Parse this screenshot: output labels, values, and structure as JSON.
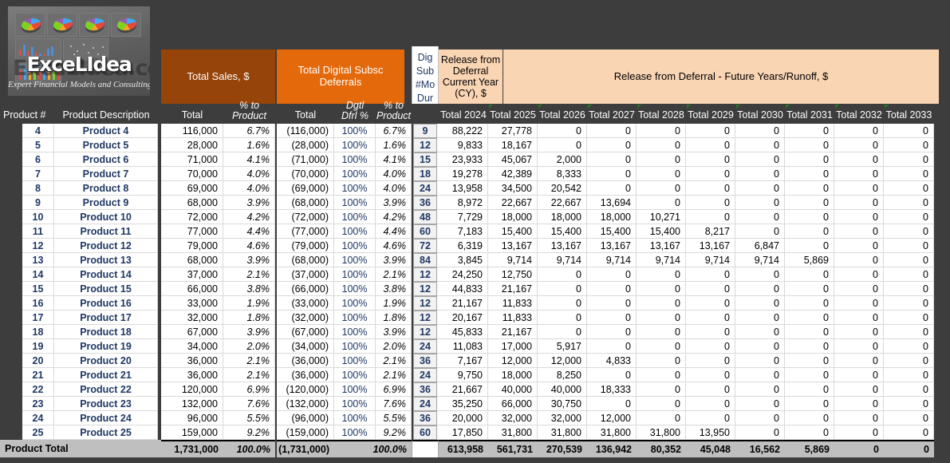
{
  "logo": {
    "brand": "ExceLIdea",
    "watermark": "ExceLIdea.com",
    "tagline": "Expert Financial Models and Consulting Services"
  },
  "bands": {
    "total_sales": "Total Sales, $",
    "digital_deferrals": "Total Digital Subsc Deferrals",
    "dig_sub_dur": "Dig Sub #Mo Dur Asmp",
    "release_cy": "Release from Deferral Current Year (CY), $",
    "release_future": "Release from Deferral - Future Years/Runoff, $"
  },
  "columns": {
    "product_num": "Product #",
    "product_desc": "Product Description",
    "sales_total": "Total",
    "sales_pct": "% to Product",
    "sales_pct_l1": "% to",
    "sales_pct_l2": "Product",
    "dfrl_total": "Total",
    "dfrl_pct_l1": "Dgtl",
    "dfrl_pct_l2": "Dfrl  %",
    "dfrl_to_prod_l1": "% to",
    "dfrl_to_prod_l2": "Product",
    "years": [
      "Total 2024",
      "Total 2025",
      "Total 2026",
      "Total 2027",
      "Total 2028",
      "Total 2029",
      "Total 2030",
      "Total 2031",
      "Total 2032",
      "Total 2033"
    ]
  },
  "colors": {
    "brown": "#96440a",
    "orange": "#e3690b",
    "peach": "#fad5b4",
    "dark_header": "#3d3d3d",
    "total_row": "#bfbfbf",
    "text_blue": "#1f3864",
    "comment_marker": "#1f7a1f"
  },
  "rows": [
    {
      "num": "4",
      "desc": "Product 4",
      "sales": "116,000",
      "pct": "6.7%",
      "dfrl": "(116,000)",
      "dfrl_pct": "100%",
      "dfrl_prod": "6.7%",
      "dur": "9",
      "y": [
        "88,222",
        "27,778",
        "0",
        "0",
        "0",
        "0",
        "0",
        "0",
        "0",
        "0"
      ]
    },
    {
      "num": "5",
      "desc": "Product 5",
      "sales": "28,000",
      "pct": "1.6%",
      "dfrl": "(28,000)",
      "dfrl_pct": "100%",
      "dfrl_prod": "1.6%",
      "dur": "12",
      "y": [
        "9,833",
        "18,167",
        "0",
        "0",
        "0",
        "0",
        "0",
        "0",
        "0",
        "0"
      ]
    },
    {
      "num": "6",
      "desc": "Product 6",
      "sales": "71,000",
      "pct": "4.1%",
      "dfrl": "(71,000)",
      "dfrl_pct": "100%",
      "dfrl_prod": "4.1%",
      "dur": "15",
      "y": [
        "23,933",
        "45,067",
        "2,000",
        "0",
        "0",
        "0",
        "0",
        "0",
        "0",
        "0"
      ]
    },
    {
      "num": "7",
      "desc": "Product 7",
      "sales": "70,000",
      "pct": "4.0%",
      "dfrl": "(70,000)",
      "dfrl_pct": "100%",
      "dfrl_prod": "4.0%",
      "dur": "18",
      "y": [
        "19,278",
        "42,389",
        "8,333",
        "0",
        "0",
        "0",
        "0",
        "0",
        "0",
        "0"
      ]
    },
    {
      "num": "8",
      "desc": "Product 8",
      "sales": "69,000",
      "pct": "4.0%",
      "dfrl": "(69,000)",
      "dfrl_pct": "100%",
      "dfrl_prod": "4.0%",
      "dur": "24",
      "y": [
        "13,958",
        "34,500",
        "20,542",
        "0",
        "0",
        "0",
        "0",
        "0",
        "0",
        "0"
      ]
    },
    {
      "num": "9",
      "desc": "Product 9",
      "sales": "68,000",
      "pct": "3.9%",
      "dfrl": "(68,000)",
      "dfrl_pct": "100%",
      "dfrl_prod": "3.9%",
      "dur": "36",
      "y": [
        "8,972",
        "22,667",
        "22,667",
        "13,694",
        "0",
        "0",
        "0",
        "0",
        "0",
        "0"
      ]
    },
    {
      "num": "10",
      "desc": "Product 10",
      "sales": "72,000",
      "pct": "4.2%",
      "dfrl": "(72,000)",
      "dfrl_pct": "100%",
      "dfrl_prod": "4.2%",
      "dur": "48",
      "y": [
        "7,729",
        "18,000",
        "18,000",
        "18,000",
        "10,271",
        "0",
        "0",
        "0",
        "0",
        "0"
      ]
    },
    {
      "num": "11",
      "desc": "Product 11",
      "sales": "77,000",
      "pct": "4.4%",
      "dfrl": "(77,000)",
      "dfrl_pct": "100%",
      "dfrl_prod": "4.4%",
      "dur": "60",
      "y": [
        "7,183",
        "15,400",
        "15,400",
        "15,400",
        "15,400",
        "8,217",
        "0",
        "0",
        "0",
        "0"
      ]
    },
    {
      "num": "12",
      "desc": "Product 12",
      "sales": "79,000",
      "pct": "4.6%",
      "dfrl": "(79,000)",
      "dfrl_pct": "100%",
      "dfrl_prod": "4.6%",
      "dur": "72",
      "y": [
        "6,319",
        "13,167",
        "13,167",
        "13,167",
        "13,167",
        "13,167",
        "6,847",
        "0",
        "0",
        "0"
      ]
    },
    {
      "num": "13",
      "desc": "Product 13",
      "sales": "68,000",
      "pct": "3.9%",
      "dfrl": "(68,000)",
      "dfrl_pct": "100%",
      "dfrl_prod": "3.9%",
      "dur": "84",
      "y": [
        "3,845",
        "9,714",
        "9,714",
        "9,714",
        "9,714",
        "9,714",
        "9,714",
        "5,869",
        "0",
        "0"
      ]
    },
    {
      "num": "14",
      "desc": "Product 14",
      "sales": "37,000",
      "pct": "2.1%",
      "dfrl": "(37,000)",
      "dfrl_pct": "100%",
      "dfrl_prod": "2.1%",
      "dur": "12",
      "y": [
        "24,250",
        "12,750",
        "0",
        "0",
        "0",
        "0",
        "0",
        "0",
        "0",
        "0"
      ]
    },
    {
      "num": "15",
      "desc": "Product 15",
      "sales": "66,000",
      "pct": "3.8%",
      "dfrl": "(66,000)",
      "dfrl_pct": "100%",
      "dfrl_prod": "3.8%",
      "dur": "12",
      "y": [
        "44,833",
        "21,167",
        "0",
        "0",
        "0",
        "0",
        "0",
        "0",
        "0",
        "0"
      ]
    },
    {
      "num": "16",
      "desc": "Product 16",
      "sales": "33,000",
      "pct": "1.9%",
      "dfrl": "(33,000)",
      "dfrl_pct": "100%",
      "dfrl_prod": "1.9%",
      "dur": "12",
      "y": [
        "21,167",
        "11,833",
        "0",
        "0",
        "0",
        "0",
        "0",
        "0",
        "0",
        "0"
      ]
    },
    {
      "num": "17",
      "desc": "Product 17",
      "sales": "32,000",
      "pct": "1.8%",
      "dfrl": "(32,000)",
      "dfrl_pct": "100%",
      "dfrl_prod": "1.8%",
      "dur": "12",
      "y": [
        "20,167",
        "11,833",
        "0",
        "0",
        "0",
        "0",
        "0",
        "0",
        "0",
        "0"
      ]
    },
    {
      "num": "18",
      "desc": "Product 18",
      "sales": "67,000",
      "pct": "3.9%",
      "dfrl": "(67,000)",
      "dfrl_pct": "100%",
      "dfrl_prod": "3.9%",
      "dur": "12",
      "y": [
        "45,833",
        "21,167",
        "0",
        "0",
        "0",
        "0",
        "0",
        "0",
        "0",
        "0"
      ]
    },
    {
      "num": "19",
      "desc": "Product 19",
      "sales": "34,000",
      "pct": "2.0%",
      "dfrl": "(34,000)",
      "dfrl_pct": "100%",
      "dfrl_prod": "2.0%",
      "dur": "24",
      "y": [
        "11,083",
        "17,000",
        "5,917",
        "0",
        "0",
        "0",
        "0",
        "0",
        "0",
        "0"
      ]
    },
    {
      "num": "20",
      "desc": "Product 20",
      "sales": "36,000",
      "pct": "2.1%",
      "dfrl": "(36,000)",
      "dfrl_pct": "100%",
      "dfrl_prod": "2.1%",
      "dur": "36",
      "y": [
        "7,167",
        "12,000",
        "12,000",
        "4,833",
        "0",
        "0",
        "0",
        "0",
        "0",
        "0"
      ]
    },
    {
      "num": "21",
      "desc": "Product 21",
      "sales": "36,000",
      "pct": "2.1%",
      "dfrl": "(36,000)",
      "dfrl_pct": "100%",
      "dfrl_prod": "2.1%",
      "dur": "24",
      "y": [
        "9,750",
        "18,000",
        "8,250",
        "0",
        "0",
        "0",
        "0",
        "0",
        "0",
        "0"
      ]
    },
    {
      "num": "22",
      "desc": "Product 22",
      "sales": "120,000",
      "pct": "6.9%",
      "dfrl": "(120,000)",
      "dfrl_pct": "100%",
      "dfrl_prod": "6.9%",
      "dur": "36",
      "y": [
        "21,667",
        "40,000",
        "40,000",
        "18,333",
        "0",
        "0",
        "0",
        "0",
        "0",
        "0"
      ]
    },
    {
      "num": "23",
      "desc": "Product 23",
      "sales": "132,000",
      "pct": "7.6%",
      "dfrl": "(132,000)",
      "dfrl_pct": "100%",
      "dfrl_prod": "7.6%",
      "dur": "24",
      "y": [
        "35,250",
        "66,000",
        "30,750",
        "0",
        "0",
        "0",
        "0",
        "0",
        "0",
        "0"
      ]
    },
    {
      "num": "24",
      "desc": "Product 24",
      "sales": "96,000",
      "pct": "5.5%",
      "dfrl": "(96,000)",
      "dfrl_pct": "100%",
      "dfrl_prod": "5.5%",
      "dur": "36",
      "y": [
        "20,000",
        "32,000",
        "32,000",
        "12,000",
        "0",
        "0",
        "0",
        "0",
        "0",
        "0"
      ]
    },
    {
      "num": "25",
      "desc": "Product 25",
      "sales": "159,000",
      "pct": "9.2%",
      "dfrl": "(159,000)",
      "dfrl_pct": "100%",
      "dfrl_prod": "9.2%",
      "dur": "60",
      "y": [
        "17,850",
        "31,800",
        "31,800",
        "31,800",
        "31,800",
        "13,950",
        "0",
        "0",
        "0",
        "0"
      ]
    }
  ],
  "total": {
    "label": "Product Total",
    "sales": "1,731,000",
    "pct": "100.0%",
    "dfrl": "(1,731,000)",
    "dfrl_pct": "",
    "dfrl_prod": "100.0%",
    "dur": "",
    "y": [
      "613,958",
      "561,731",
      "270,539",
      "136,942",
      "80,352",
      "45,048",
      "16,562",
      "5,869",
      "0",
      "0"
    ]
  }
}
